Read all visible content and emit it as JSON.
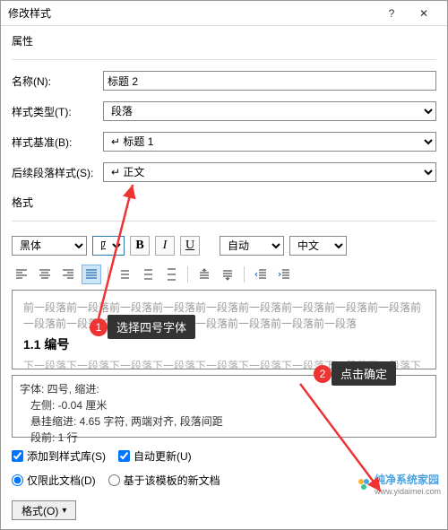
{
  "title": "修改样式",
  "sections": {
    "props": "属性",
    "format": "格式"
  },
  "labels": {
    "name": "名称(N):",
    "styleType": "样式类型(T):",
    "basedOn": "样式基准(B):",
    "nextPara": "后续段落样式(S):"
  },
  "values": {
    "name": "标题 2",
    "styleType": "段落",
    "basedOn": "↵ 标题 1",
    "nextPara": "↵ 正文",
    "font": "黑体",
    "size": "四号",
    "auto": "自动",
    "lang": "中文"
  },
  "preview": {
    "above": "前一段落前一段落前一段落前一段落前一段落前一段落前一段落前一段落前一段落前一段落前一段落前一段落前一段落前一段落前一段落前一段落前一段落",
    "heading": "1.1 编号",
    "below": "下一段落下一段落下一段落下一段落下一段落下一段落下一段落下一段落下一段落下一段落下一段落下一段落下一段落下一段落下一段落下一段落下一段落下一段落下一段落下一段落下一段落下一段落"
  },
  "desc": {
    "l1": "字体: 四号, 缩进:",
    "l2": "左侧:  -0.04 厘米",
    "l3": "悬挂缩进: 4.65 字符, 两端对齐, 段落间距",
    "l4": "段前: 1 行"
  },
  "checks": {
    "lib": "添加到样式库(S)",
    "auto": "自动更新(U)"
  },
  "radios": {
    "doc": "仅限此文档(D)",
    "tpl": "基于该模板的新文档"
  },
  "buttons": {
    "format": "格式(O)"
  },
  "callouts": {
    "c1": "选择四号字体",
    "c2": "点击确定",
    "n1": "1",
    "n2": "2"
  },
  "watermark": {
    "text": "纯净系统家园",
    "url": "www.yidaimei.com"
  }
}
